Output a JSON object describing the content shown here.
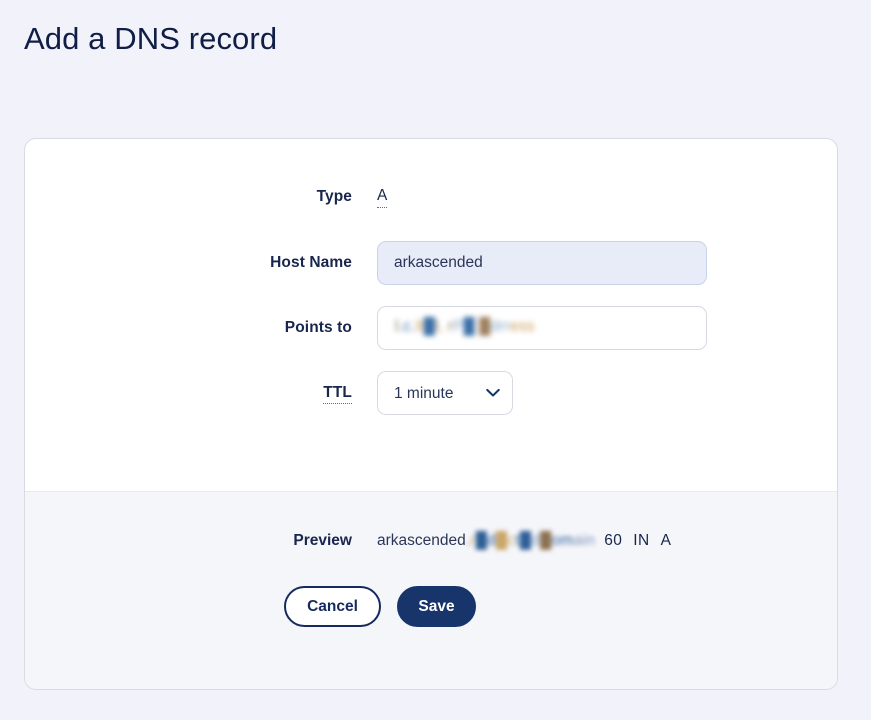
{
  "page": {
    "title": "Add a DNS record",
    "background_color": "#f2f2fb",
    "accent_color": "#17356b"
  },
  "form": {
    "type": {
      "label": "Type",
      "value": "A"
    },
    "host_name": {
      "label": "Host Name",
      "value": "arkascended",
      "placeholder": "",
      "state": "autofilled",
      "fill_color": "#e8ecf8"
    },
    "points_to": {
      "label": "Points to",
      "value": "redacted domain address",
      "placeholder": "",
      "state": "blurred"
    },
    "ttl": {
      "label": "TTL",
      "selected": "1 minute",
      "options": [
        "1 minute"
      ]
    }
  },
  "footer": {
    "preview": {
      "label": "Preview",
      "host": "arkascended",
      "domain_blurred": ".redacteddomain.example",
      "ttl_seconds": "60",
      "class": "IN",
      "record_type": "A"
    },
    "buttons": {
      "cancel": "Cancel",
      "save": "Save"
    }
  },
  "icons": {
    "chevron_down": "chevron-down-icon"
  }
}
